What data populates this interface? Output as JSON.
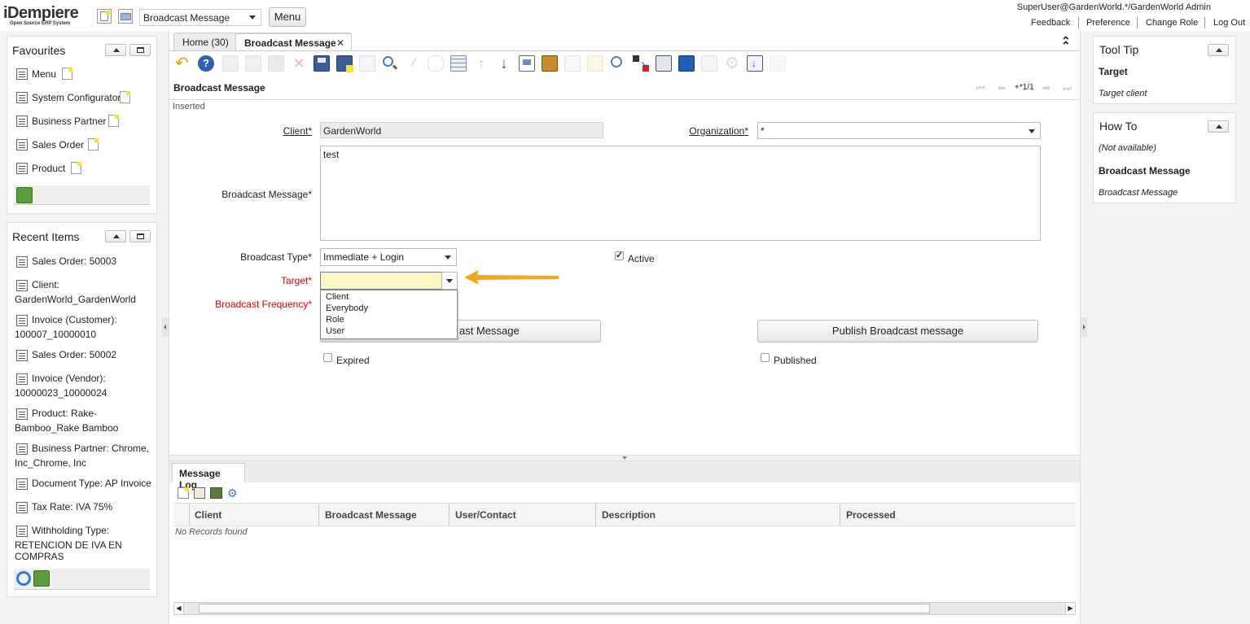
{
  "header": {
    "logo_text": "iDempiere",
    "logo_sub": "Open Source ERP System",
    "window_select": "Broadcast Message",
    "menu_button": "Menu",
    "user_line": "SuperUser@GardenWorld.*/GardenWorld Admin",
    "links": [
      "Feedback",
      "Preference",
      "Change Role",
      "Log Out"
    ]
  },
  "favourites": {
    "title": "Favourites",
    "items": [
      "Menu",
      "System Configurator",
      "Business Partner",
      "Sales Order",
      "Product"
    ]
  },
  "recent": {
    "title": "Recent Items",
    "items": [
      {
        "line1": "Sales Order: 50003",
        "line2": ""
      },
      {
        "line1": "Client:",
        "line2": "GardenWorld_GardenWorld"
      },
      {
        "line1": "Invoice (Customer):",
        "line2": "100007_10000010"
      },
      {
        "line1": "Sales Order: 50002",
        "line2": ""
      },
      {
        "line1": "Invoice (Vendor):",
        "line2": "10000023_10000024"
      },
      {
        "line1": "Product: Rake-",
        "line2": "Bamboo_Rake Bamboo"
      },
      {
        "line1": "Business Partner: Chrome,",
        "line2": "Inc_Chrome, Inc"
      },
      {
        "line1": "Document Type: AP Invoice",
        "line2": ""
      },
      {
        "line1": "Tax Rate: IVA 75%",
        "line2": ""
      },
      {
        "line1": "Withholding Type:",
        "line2": "RETENCION DE IVA EN",
        "line3": "COMPRAS"
      }
    ]
  },
  "tabs": [
    {
      "label": "Home (30)"
    },
    {
      "label": "Broadcast Message"
    }
  ],
  "window": {
    "title": "Broadcast Message",
    "record_nav": "+*1/1",
    "status": "Inserted"
  },
  "form": {
    "client_label": "Client",
    "client_value": "GardenWorld",
    "org_label": "Organization",
    "org_value": "*",
    "message_label": "Broadcast Message",
    "message_value": "test",
    "type_label": "Broadcast Type",
    "type_value": "Immediate + Login",
    "active_label": "Active",
    "target_label": "Target",
    "target_value": "",
    "target_options": [
      "Client",
      "Everybody",
      "Role",
      "User"
    ],
    "frequency_label": "Broadcast Frequency",
    "left_button": "ast Message",
    "publish_button": "Publish Broadcast message",
    "expired_label": "Expired",
    "published_label": "Published",
    "required_mark": "*"
  },
  "message_log": {
    "tab": "Message Log",
    "columns": [
      "Client",
      "Broadcast Message",
      "User/Contact",
      "Description",
      "Processed"
    ],
    "empty_text": "No Records found"
  },
  "tooltip": {
    "title": "Tool Tip",
    "field": "Target",
    "text": "Target client"
  },
  "howto": {
    "title": "How To",
    "na": "(Not available)",
    "heading": "Broadcast Message",
    "text": "Broadcast Message"
  },
  "colors": {
    "highlight_field": "#fdf6c3",
    "arrow": "#f5a623",
    "required_red": "#d00000",
    "toolbar_blue": "#1a4fa0"
  }
}
